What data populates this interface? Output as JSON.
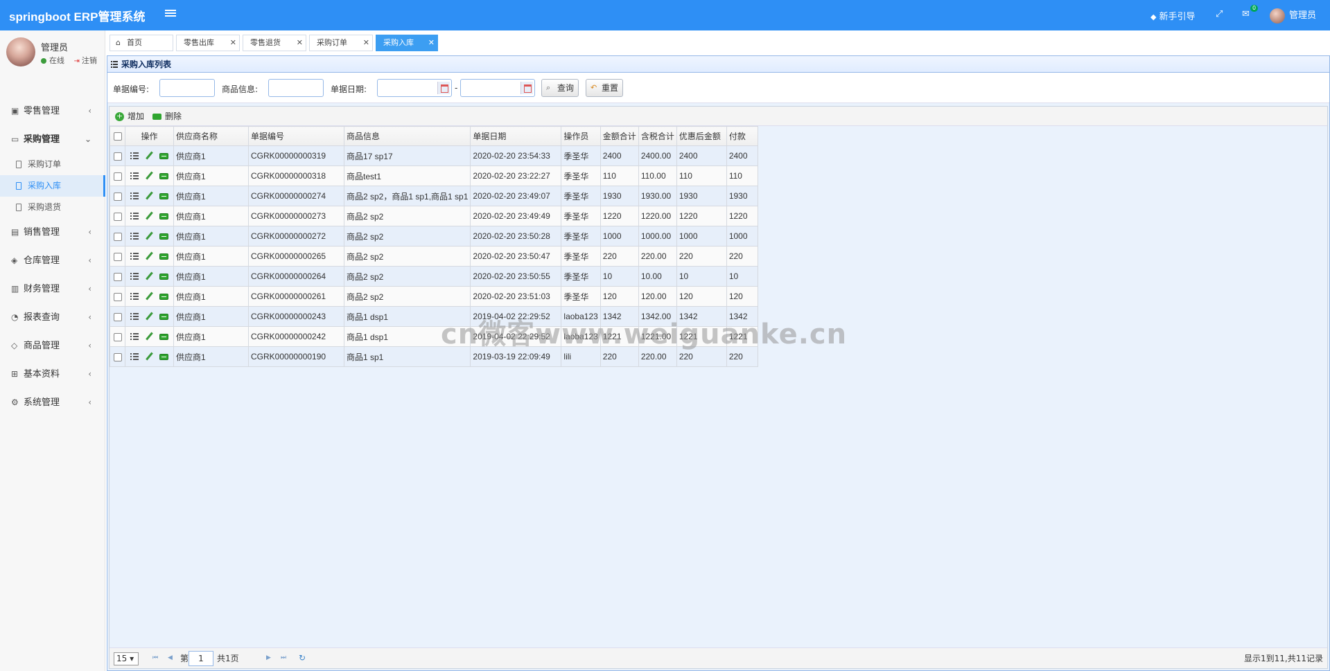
{
  "app": {
    "title": "springboot ERP管理系统"
  },
  "header": {
    "guide": "新手引导",
    "msg_count": "0",
    "user": "管理员"
  },
  "user_panel": {
    "name": "管理员",
    "status": "在线",
    "logout": "注销"
  },
  "sidebar": {
    "items": [
      {
        "label": "零售管理",
        "icon": "gift-icon"
      },
      {
        "label": "采购管理",
        "icon": "monitor-icon",
        "open": true,
        "children": [
          {
            "label": "采购订单"
          },
          {
            "label": "采购入库",
            "active": true
          },
          {
            "label": "采购退货"
          }
        ]
      },
      {
        "label": "销售管理",
        "icon": "package-icon"
      },
      {
        "label": "仓库管理",
        "icon": "layers-icon"
      },
      {
        "label": "财务管理",
        "icon": "book-icon"
      },
      {
        "label": "报表查询",
        "icon": "pie-icon"
      },
      {
        "label": "商品管理",
        "icon": "box-icon"
      },
      {
        "label": "基本资料",
        "icon": "grid-icon"
      },
      {
        "label": "系统管理",
        "icon": "gear-icon"
      }
    ]
  },
  "tabs": [
    {
      "label": "首页",
      "icon": "home-icon",
      "closable": false
    },
    {
      "label": "零售出库",
      "closable": true
    },
    {
      "label": "零售退货",
      "closable": true
    },
    {
      "label": "采购订单",
      "closable": true
    },
    {
      "label": "采购入库",
      "closable": true,
      "active": true
    }
  ],
  "panel": {
    "title": "采购入库列表"
  },
  "search": {
    "number_label": "单据编号:",
    "goods_label": "商品信息:",
    "date_label": "单据日期:",
    "date_sep": "-",
    "query_btn": "查询",
    "reset_btn": "重置"
  },
  "toolbar": {
    "add": "增加",
    "delete": "删除"
  },
  "table": {
    "columns": [
      "操作",
      "供应商名称",
      "单据编号",
      "商品信息",
      "单据日期",
      "操作员",
      "金额合计",
      "含税合计",
      "优惠后金额",
      "付款"
    ],
    "rows": [
      [
        "供应商1",
        "CGRK00000000319",
        "商品17 sp17",
        "2020-02-20 23:54:33",
        "季圣华",
        "2400",
        "2400.00",
        "2400",
        "2400"
      ],
      [
        "供应商1",
        "CGRK00000000318",
        "商品test1",
        "2020-02-20 23:22:27",
        "季圣华",
        "110",
        "110.00",
        "110",
        "110"
      ],
      [
        "供应商1",
        "CGRK00000000274",
        "商品2 sp2，商品1 sp1,商品1 sp1",
        "2020-02-20 23:49:07",
        "季圣华",
        "1930",
        "1930.00",
        "1930",
        "1930"
      ],
      [
        "供应商1",
        "CGRK00000000273",
        "商品2 sp2",
        "2020-02-20 23:49:49",
        "季圣华",
        "1220",
        "1220.00",
        "1220",
        "1220"
      ],
      [
        "供应商1",
        "CGRK00000000272",
        "商品2 sp2",
        "2020-02-20 23:50:28",
        "季圣华",
        "1000",
        "1000.00",
        "1000",
        "1000"
      ],
      [
        "供应商1",
        "CGRK00000000265",
        "商品2 sp2",
        "2020-02-20 23:50:47",
        "季圣华",
        "220",
        "220.00",
        "220",
        "220"
      ],
      [
        "供应商1",
        "CGRK00000000264",
        "商品2 sp2",
        "2020-02-20 23:50:55",
        "季圣华",
        "10",
        "10.00",
        "10",
        "10"
      ],
      [
        "供应商1",
        "CGRK00000000261",
        "商品2 sp2",
        "2020-02-20 23:51:03",
        "季圣华",
        "120",
        "120.00",
        "120",
        "120"
      ],
      [
        "供应商1",
        "CGRK00000000243",
        "商品1 dsp1",
        "2019-04-02 22:29:52",
        "laoba123",
        "1342",
        "1342.00",
        "1342",
        "1342"
      ],
      [
        "供应商1",
        "CGRK00000000242",
        "商品1 dsp1",
        "2019-04-02 22:29:52",
        "laoba123",
        "1221",
        "1221.00",
        "1221",
        "1221"
      ],
      [
        "供应商1",
        "CGRK00000000190",
        "商品1 sp1",
        "2019-03-19 22:09:49",
        "lili",
        "220",
        "220.00",
        "220",
        "220"
      ]
    ]
  },
  "pager": {
    "page_size": "15",
    "page_prefix": "第",
    "page_value": "1",
    "page_total": "共1页",
    "summary": "显示1到11,共11记录"
  },
  "watermark": "cn微客www.weiguanke.cn"
}
